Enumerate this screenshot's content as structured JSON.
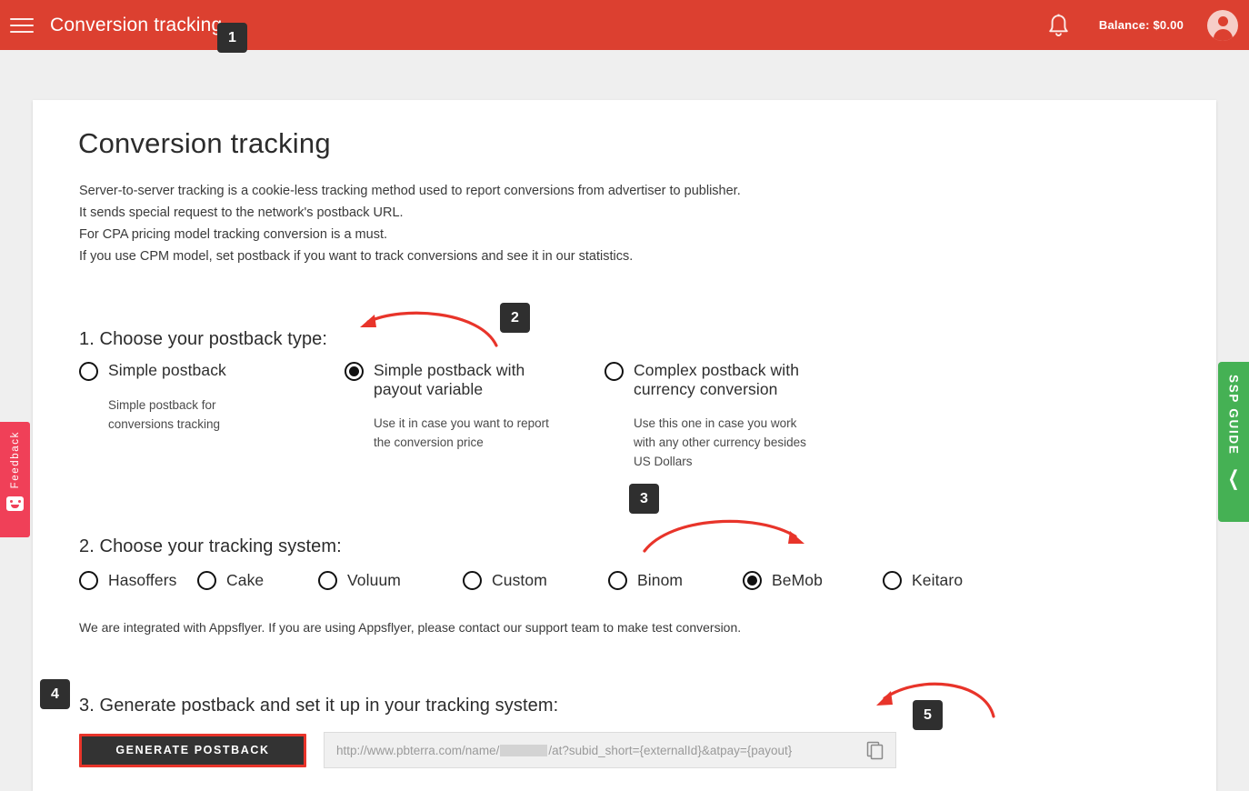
{
  "header": {
    "menu_icon": "hamburger-menu-icon",
    "title": "Conversion tracking",
    "bell_icon": "notification-bell-icon",
    "balance": "Balance: $0.00",
    "avatar_icon": "user-avatar-icon"
  },
  "page": {
    "title": "Conversion tracking",
    "intro": [
      "Server-to-server tracking is a cookie-less tracking method used to report conversions from advertiser to publisher.",
      "It sends special request to the network's postback URL.",
      "For CPA pricing model tracking conversion is a must.",
      "If you use CPM model, set postback if you want to track conversions and see it in our statistics."
    ]
  },
  "step1": {
    "title": "1. Choose your postback type:",
    "options": [
      {
        "label": "Simple postback",
        "desc": "Simple postback for conversions tracking",
        "selected": false
      },
      {
        "label": "Simple postback with payout variable",
        "desc": "Use it in case you want to report the conversion price",
        "selected": true
      },
      {
        "label": "Complex postback with currency conversion",
        "desc": "Use this one in case you work with any other currency besides US Dollars",
        "selected": false
      }
    ]
  },
  "step2": {
    "title": "2. Choose your tracking system:",
    "options": [
      {
        "label": "Hasoffers",
        "selected": false
      },
      {
        "label": "Cake",
        "selected": false
      },
      {
        "label": "Voluum",
        "selected": false
      },
      {
        "label": "Custom",
        "selected": false
      },
      {
        "label": "Binom",
        "selected": false
      },
      {
        "label": "BeMob",
        "selected": true
      },
      {
        "label": "Keitaro",
        "selected": false
      }
    ],
    "note": "We are integrated with Appsflyer. If you are using Appsflyer, please contact our support team to make test conversion."
  },
  "step3": {
    "title": "3. Generate postback and set it up in your tracking system:",
    "generate_label": "GENERATE POSTBACK",
    "url_prefix": "http://www.pbterra.com/name/",
    "url_suffix": "/at?subid_short={externalId}&atpay={payout}",
    "copy_icon": "copy-icon"
  },
  "callouts": [
    {
      "number": "1"
    },
    {
      "number": "2"
    },
    {
      "number": "3"
    },
    {
      "number": "4"
    },
    {
      "number": "5"
    }
  ],
  "side_tabs": {
    "feedback": {
      "label": "Feedback",
      "icon": "smiley-face-icon"
    },
    "ssp_guide": {
      "label": "SSP GUIDE",
      "icon": "chevron-left-icon"
    }
  },
  "colors": {
    "header_red": "#dc4030",
    "accent_red": "#e8342a",
    "feedback_pink": "#f04058",
    "ssp_green": "#45b154",
    "badge_dark": "#2f2f2f",
    "page_bg": "#efefef"
  }
}
